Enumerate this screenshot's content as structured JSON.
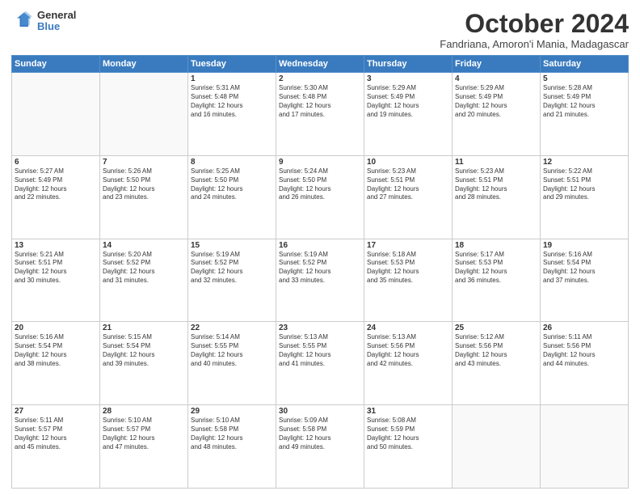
{
  "logo": {
    "general": "General",
    "blue": "Blue"
  },
  "header": {
    "month": "October 2024",
    "location": "Fandriana, Amoron'i Mania, Madagascar"
  },
  "weekdays": [
    "Sunday",
    "Monday",
    "Tuesday",
    "Wednesday",
    "Thursday",
    "Friday",
    "Saturday"
  ],
  "weeks": [
    [
      {
        "day": "",
        "info": ""
      },
      {
        "day": "",
        "info": ""
      },
      {
        "day": "1",
        "info": "Sunrise: 5:31 AM\nSunset: 5:48 PM\nDaylight: 12 hours\nand 16 minutes."
      },
      {
        "day": "2",
        "info": "Sunrise: 5:30 AM\nSunset: 5:48 PM\nDaylight: 12 hours\nand 17 minutes."
      },
      {
        "day": "3",
        "info": "Sunrise: 5:29 AM\nSunset: 5:49 PM\nDaylight: 12 hours\nand 19 minutes."
      },
      {
        "day": "4",
        "info": "Sunrise: 5:29 AM\nSunset: 5:49 PM\nDaylight: 12 hours\nand 20 minutes."
      },
      {
        "day": "5",
        "info": "Sunrise: 5:28 AM\nSunset: 5:49 PM\nDaylight: 12 hours\nand 21 minutes."
      }
    ],
    [
      {
        "day": "6",
        "info": "Sunrise: 5:27 AM\nSunset: 5:49 PM\nDaylight: 12 hours\nand 22 minutes."
      },
      {
        "day": "7",
        "info": "Sunrise: 5:26 AM\nSunset: 5:50 PM\nDaylight: 12 hours\nand 23 minutes."
      },
      {
        "day": "8",
        "info": "Sunrise: 5:25 AM\nSunset: 5:50 PM\nDaylight: 12 hours\nand 24 minutes."
      },
      {
        "day": "9",
        "info": "Sunrise: 5:24 AM\nSunset: 5:50 PM\nDaylight: 12 hours\nand 26 minutes."
      },
      {
        "day": "10",
        "info": "Sunrise: 5:23 AM\nSunset: 5:51 PM\nDaylight: 12 hours\nand 27 minutes."
      },
      {
        "day": "11",
        "info": "Sunrise: 5:23 AM\nSunset: 5:51 PM\nDaylight: 12 hours\nand 28 minutes."
      },
      {
        "day": "12",
        "info": "Sunrise: 5:22 AM\nSunset: 5:51 PM\nDaylight: 12 hours\nand 29 minutes."
      }
    ],
    [
      {
        "day": "13",
        "info": "Sunrise: 5:21 AM\nSunset: 5:51 PM\nDaylight: 12 hours\nand 30 minutes."
      },
      {
        "day": "14",
        "info": "Sunrise: 5:20 AM\nSunset: 5:52 PM\nDaylight: 12 hours\nand 31 minutes."
      },
      {
        "day": "15",
        "info": "Sunrise: 5:19 AM\nSunset: 5:52 PM\nDaylight: 12 hours\nand 32 minutes."
      },
      {
        "day": "16",
        "info": "Sunrise: 5:19 AM\nSunset: 5:52 PM\nDaylight: 12 hours\nand 33 minutes."
      },
      {
        "day": "17",
        "info": "Sunrise: 5:18 AM\nSunset: 5:53 PM\nDaylight: 12 hours\nand 35 minutes."
      },
      {
        "day": "18",
        "info": "Sunrise: 5:17 AM\nSunset: 5:53 PM\nDaylight: 12 hours\nand 36 minutes."
      },
      {
        "day": "19",
        "info": "Sunrise: 5:16 AM\nSunset: 5:54 PM\nDaylight: 12 hours\nand 37 minutes."
      }
    ],
    [
      {
        "day": "20",
        "info": "Sunrise: 5:16 AM\nSunset: 5:54 PM\nDaylight: 12 hours\nand 38 minutes."
      },
      {
        "day": "21",
        "info": "Sunrise: 5:15 AM\nSunset: 5:54 PM\nDaylight: 12 hours\nand 39 minutes."
      },
      {
        "day": "22",
        "info": "Sunrise: 5:14 AM\nSunset: 5:55 PM\nDaylight: 12 hours\nand 40 minutes."
      },
      {
        "day": "23",
        "info": "Sunrise: 5:13 AM\nSunset: 5:55 PM\nDaylight: 12 hours\nand 41 minutes."
      },
      {
        "day": "24",
        "info": "Sunrise: 5:13 AM\nSunset: 5:56 PM\nDaylight: 12 hours\nand 42 minutes."
      },
      {
        "day": "25",
        "info": "Sunrise: 5:12 AM\nSunset: 5:56 PM\nDaylight: 12 hours\nand 43 minutes."
      },
      {
        "day": "26",
        "info": "Sunrise: 5:11 AM\nSunset: 5:56 PM\nDaylight: 12 hours\nand 44 minutes."
      }
    ],
    [
      {
        "day": "27",
        "info": "Sunrise: 5:11 AM\nSunset: 5:57 PM\nDaylight: 12 hours\nand 45 minutes."
      },
      {
        "day": "28",
        "info": "Sunrise: 5:10 AM\nSunset: 5:57 PM\nDaylight: 12 hours\nand 47 minutes."
      },
      {
        "day": "29",
        "info": "Sunrise: 5:10 AM\nSunset: 5:58 PM\nDaylight: 12 hours\nand 48 minutes."
      },
      {
        "day": "30",
        "info": "Sunrise: 5:09 AM\nSunset: 5:58 PM\nDaylight: 12 hours\nand 49 minutes."
      },
      {
        "day": "31",
        "info": "Sunrise: 5:08 AM\nSunset: 5:59 PM\nDaylight: 12 hours\nand 50 minutes."
      },
      {
        "day": "",
        "info": ""
      },
      {
        "day": "",
        "info": ""
      }
    ]
  ]
}
